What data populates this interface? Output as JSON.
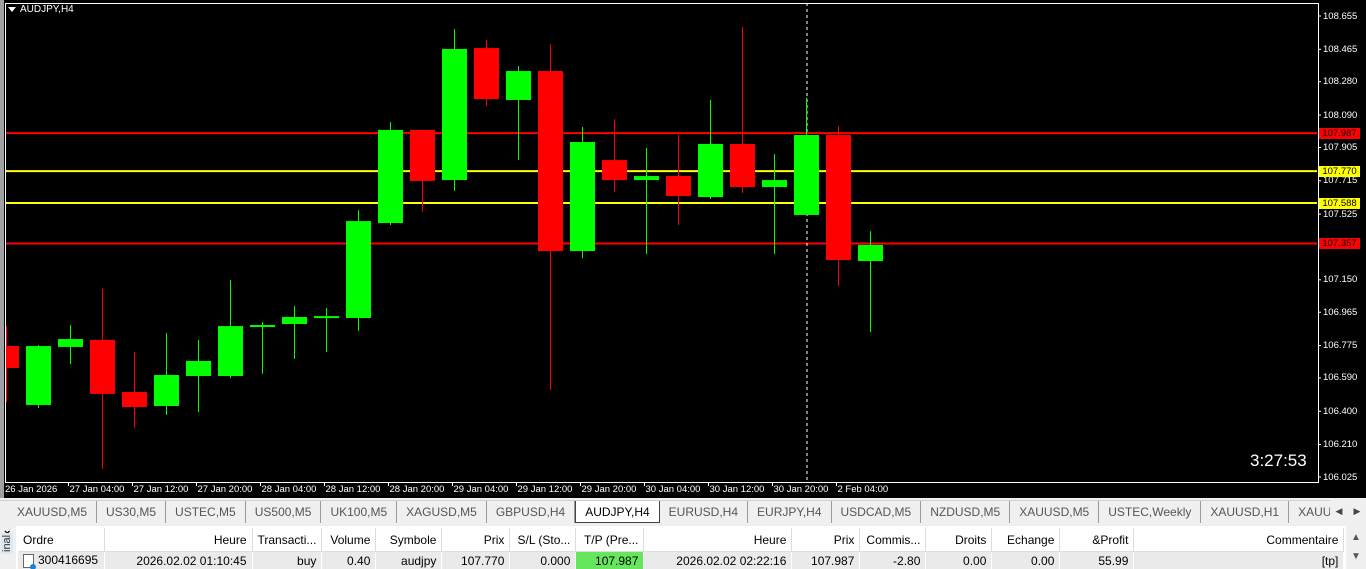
{
  "chart": {
    "title": "AUDJPY,H4",
    "timer": "3:27:53",
    "colors": {
      "background": "#000000",
      "bull": "#00ff00",
      "bear": "#ff0000",
      "frame": "#ffffff"
    }
  },
  "chart_data": {
    "type": "candlestick",
    "symbol": "AUDJPY",
    "timeframe": "H4",
    "ylim": [
      106.025,
      108.655
    ],
    "y_ticks": [
      "108.655",
      "108.465",
      "108.280",
      "108.090",
      "107.905",
      "107.715",
      "107.525",
      "107.150",
      "106.965",
      "106.775",
      "106.590",
      "106.400",
      "106.210",
      "106.025"
    ],
    "x_ticks": [
      {
        "time": "26 Jan 20:00",
        "label": "26 Jan 2026"
      },
      {
        "time": "27 Jan 04:00",
        "label": "27 Jan 04:00"
      },
      {
        "time": "27 Jan 12:00",
        "label": "27 Jan 12:00"
      },
      {
        "time": "27 Jan 20:00",
        "label": "27 Jan 20:00"
      },
      {
        "time": "28 Jan 04:00",
        "label": "28 Jan 04:00"
      },
      {
        "time": "28 Jan 12:00",
        "label": "28 Jan 12:00"
      },
      {
        "time": "28 Jan 20:00",
        "label": "28 Jan 20:00"
      },
      {
        "time": "29 Jan 04:00",
        "label": "29 Jan 04:00"
      },
      {
        "time": "29 Jan 12:00",
        "label": "29 Jan 12:00"
      },
      {
        "time": "29 Jan 20:00",
        "label": "29 Jan 20:00"
      },
      {
        "time": "30 Jan 04:00",
        "label": "30 Jan 04:00"
      },
      {
        "time": "30 Jan 12:00",
        "label": "30 Jan 12:00"
      },
      {
        "time": "30 Jan 20:00",
        "label": "30 Jan 20:00"
      },
      {
        "time": "2 Feb 04:00",
        "label": "2 Feb 04:00"
      }
    ],
    "candles": [
      {
        "t": "26 Jan 20:00",
        "o": 106.772,
        "h": 106.886,
        "l": 106.453,
        "c": 106.647
      },
      {
        "t": "27 Jan 00:00",
        "o": 106.436,
        "h": 106.778,
        "l": 106.419,
        "c": 106.772
      },
      {
        "t": "27 Jan 04:00",
        "o": 106.767,
        "h": 106.892,
        "l": 106.67,
        "c": 106.812
      },
      {
        "t": "27 Jan 08:00",
        "o": 106.807,
        "h": 107.098,
        "l": 106.071,
        "c": 106.499
      },
      {
        "t": "27 Jan 12:00",
        "o": 106.51,
        "h": 106.738,
        "l": 106.305,
        "c": 106.424
      },
      {
        "t": "27 Jan 16:00",
        "o": 106.43,
        "h": 106.847,
        "l": 106.379,
        "c": 106.607
      },
      {
        "t": "27 Jan 20:00",
        "o": 106.601,
        "h": 106.807,
        "l": 106.396,
        "c": 106.687
      },
      {
        "t": "28 Jan 00:00",
        "o": 106.601,
        "h": 107.149,
        "l": 106.59,
        "c": 106.886
      },
      {
        "t": "28 Jan 04:00",
        "o": 106.881,
        "h": 106.909,
        "l": 106.613,
        "c": 106.892
      },
      {
        "t": "28 Jan 08:00",
        "o": 106.898,
        "h": 107.001,
        "l": 106.698,
        "c": 106.938
      },
      {
        "t": "28 Jan 12:00",
        "o": 106.932,
        "h": 106.989,
        "l": 106.738,
        "c": 106.943
      },
      {
        "t": "28 Jan 16:00",
        "o": 106.932,
        "h": 107.548,
        "l": 106.858,
        "c": 107.485
      },
      {
        "t": "28 Jan 20:00",
        "o": 107.474,
        "h": 108.05,
        "l": 107.463,
        "c": 108.005
      },
      {
        "t": "29 Jan 00:00",
        "o": 108.005,
        "h": 108.005,
        "l": 107.537,
        "c": 107.714
      },
      {
        "t": "29 Jan 04:00",
        "o": 107.719,
        "h": 108.581,
        "l": 107.657,
        "c": 108.467
      },
      {
        "t": "29 Jan 08:00",
        "o": 108.472,
        "h": 108.518,
        "l": 108.142,
        "c": 108.181
      },
      {
        "t": "29 Jan 12:00",
        "o": 108.176,
        "h": 108.37,
        "l": 107.833,
        "c": 108.341
      },
      {
        "t": "29 Jan 16:00",
        "o": 108.341,
        "h": 108.495,
        "l": 106.521,
        "c": 107.314
      },
      {
        "t": "29 Jan 20:00",
        "o": 107.314,
        "h": 108.022,
        "l": 107.274,
        "c": 107.936
      },
      {
        "t": "30 Jan 00:00",
        "o": 107.833,
        "h": 108.067,
        "l": 107.651,
        "c": 107.719
      },
      {
        "t": "30 Jan 04:00",
        "o": 107.719,
        "h": 107.902,
        "l": 107.297,
        "c": 107.742
      },
      {
        "t": "30 Jan 08:00",
        "o": 107.742,
        "h": 107.976,
        "l": 107.463,
        "c": 107.628
      },
      {
        "t": "30 Jan 12:00",
        "o": 107.622,
        "h": 108.176,
        "l": 107.611,
        "c": 107.925
      },
      {
        "t": "30 Jan 16:00",
        "o": 107.925,
        "h": 108.592,
        "l": 107.645,
        "c": 107.679
      },
      {
        "t": "30 Jan 20:00",
        "o": 107.679,
        "h": 107.868,
        "l": 107.297,
        "c": 107.719
      },
      {
        "t": "2 Feb 00:00",
        "o": 107.52,
        "h": 108.187,
        "l": 107.52,
        "c": 107.976
      },
      {
        "t": "2 Feb 04:00",
        "o": 107.976,
        "h": 108.027,
        "l": 107.115,
        "c": 107.263
      },
      {
        "t": "2 Feb 08:00",
        "o": 107.257,
        "h": 107.428,
        "l": 106.852,
        "c": 107.349
      }
    ],
    "levels": [
      {
        "price": 107.987,
        "label": "107.987",
        "color": "#ff0000"
      },
      {
        "price": 107.77,
        "label": "107.770",
        "color": "#ffff00"
      },
      {
        "price": 107.588,
        "label": "107.588",
        "color": "#ffff00"
      },
      {
        "price": 107.357,
        "label": "107.357",
        "color": "#ff0000"
      }
    ],
    "crosshair_time": "2 Feb 00:00",
    "grid": false
  },
  "tabs": [
    {
      "label": "XAUUSD,M5"
    },
    {
      "label": "US30,M5"
    },
    {
      "label": "USTEC,M5"
    },
    {
      "label": "US500,M5"
    },
    {
      "label": "UK100,M5"
    },
    {
      "label": "XAGUSD,M5"
    },
    {
      "label": "GBPUSD,H4"
    },
    {
      "label": "AUDJPY,H4",
      "active": true
    },
    {
      "label": "EURUSD,H4"
    },
    {
      "label": "EURJPY,H4"
    },
    {
      "label": "USDCAD,M5"
    },
    {
      "label": "NZDUSD,M5"
    },
    {
      "label": "XAUUSD,M5"
    },
    {
      "label": "USTEC,Weekly"
    },
    {
      "label": "XAUUSD,H1"
    },
    {
      "label": "XAUUSD,W"
    }
  ],
  "terminal": {
    "side_label": "inal",
    "columns": [
      "Ordre",
      "Heure",
      "Transacti...",
      "Volume",
      "Symbole",
      "Prix",
      "S/L (Sto...",
      "T/P (Pre...",
      "Heure",
      "Prix",
      "Commis...",
      "Droits",
      "Echange",
      "&Profit",
      "Commentaire"
    ],
    "rows": [
      [
        "300416695",
        "2026.02.02 01:10:45",
        "buy",
        "0.40",
        "audjpy",
        "107.770",
        "0.000",
        "107.987",
        "2026.02.02 02:22:16",
        "107.987",
        "-2.80",
        "0.00",
        "0.00",
        "55.99",
        "[tp]"
      ]
    ],
    "tp_highlight": "#66e65c"
  }
}
